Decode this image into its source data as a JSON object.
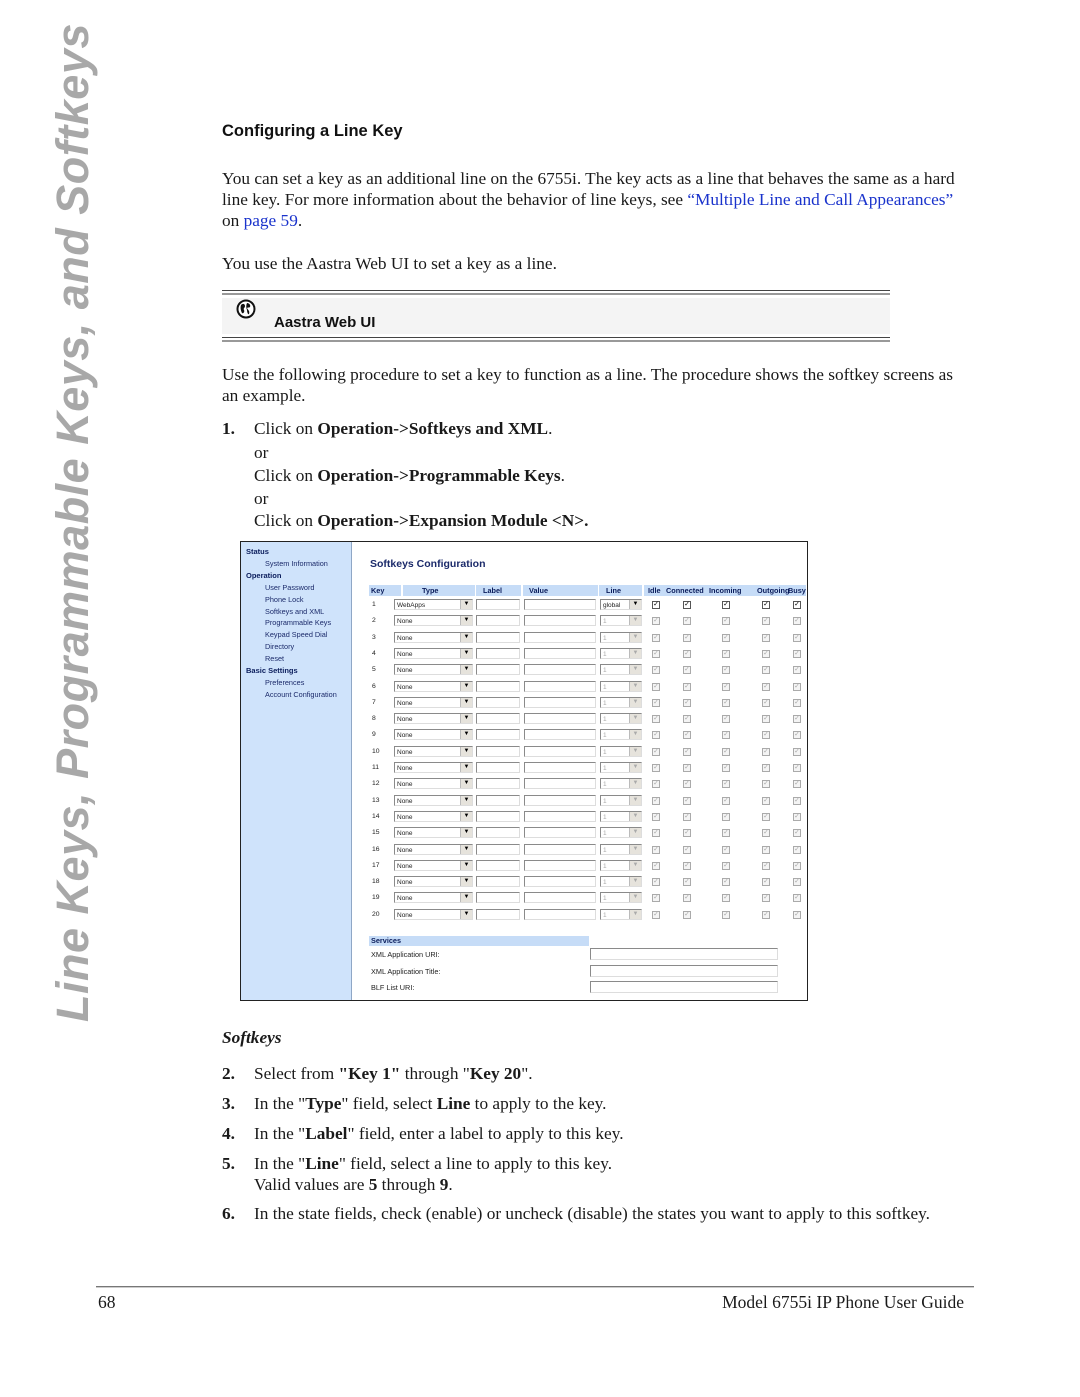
{
  "side_tab": "Line Keys, Programmable Keys, and Softkeys",
  "section_title": "Configuring a Line Key",
  "intro": {
    "text_before": "You can set a key as an additional line on the 6755i. The key acts as a line that behaves the same as a hard line key. For more information about the behavior of line keys, see ",
    "link1": "“Multiple Line and Call Appearances”",
    "text_mid": " on ",
    "link2": "page 59",
    "text_after": "."
  },
  "use_web_ui": "You use the Aastra Web UI to set a key as a line.",
  "web_ui_box": {
    "icon": "globe-icon",
    "label": "Aastra Web UI"
  },
  "procedure_intro": "Use the following procedure to set a key to function as a line. The procedure shows the softkey screens as an example.",
  "step1": {
    "num": "1.",
    "a_pre": "Click on ",
    "a_bold": "Operation->Softkeys and XML",
    "a_post": ".",
    "or1": "or",
    "b_pre": "Click on ",
    "b_bold": "Operation->Programmable Keys",
    "b_post": ".",
    "or2": "or",
    "c_pre": "Click on ",
    "c_bold": "Operation->Expansion Module <N>."
  },
  "screenshot": {
    "nav": [
      {
        "type": "header",
        "label": "Status"
      },
      {
        "type": "item",
        "label": "System Information"
      },
      {
        "type": "header",
        "label": "Operation"
      },
      {
        "type": "item",
        "label": "User Password"
      },
      {
        "type": "item",
        "label": "Phone Lock"
      },
      {
        "type": "item",
        "label": "Softkeys and XML"
      },
      {
        "type": "item",
        "label": "Programmable Keys"
      },
      {
        "type": "item",
        "label": "Keypad Speed Dial"
      },
      {
        "type": "item",
        "label": "Directory"
      },
      {
        "type": "item",
        "label": "Reset"
      },
      {
        "type": "header",
        "label": "Basic Settings"
      },
      {
        "type": "item",
        "label": "Preferences"
      },
      {
        "type": "item",
        "label": "Account Configuration"
      }
    ],
    "title": "Softkeys Configuration",
    "columns": [
      "Key",
      "Type",
      "Label",
      "Value",
      "Line",
      "Idle",
      "Connected",
      "Incoming",
      "Outgoing",
      "Busy"
    ],
    "rows": [
      {
        "key": "1",
        "type": "WebApps",
        "label": "",
        "value": "",
        "line": "global",
        "enabled": true,
        "states": [
          true,
          true,
          true,
          true,
          true
        ]
      },
      {
        "key": "2",
        "type": "None",
        "label": "",
        "value": "",
        "line": "1",
        "enabled": false,
        "states": [
          true,
          true,
          true,
          true,
          true
        ]
      },
      {
        "key": "3",
        "type": "None",
        "label": "",
        "value": "",
        "line": "1",
        "enabled": false,
        "states": [
          true,
          true,
          true,
          true,
          true
        ]
      },
      {
        "key": "4",
        "type": "None",
        "label": "",
        "value": "",
        "line": "1",
        "enabled": false,
        "states": [
          true,
          true,
          true,
          true,
          true
        ]
      },
      {
        "key": "5",
        "type": "None",
        "label": "",
        "value": "",
        "line": "1",
        "enabled": false,
        "states": [
          true,
          true,
          true,
          true,
          true
        ]
      },
      {
        "key": "6",
        "type": "None",
        "label": "",
        "value": "",
        "line": "1",
        "enabled": false,
        "states": [
          true,
          true,
          true,
          true,
          true
        ]
      },
      {
        "key": "7",
        "type": "None",
        "label": "",
        "value": "",
        "line": "1",
        "enabled": false,
        "states": [
          true,
          true,
          true,
          true,
          true
        ]
      },
      {
        "key": "8",
        "type": "None",
        "label": "",
        "value": "",
        "line": "1",
        "enabled": false,
        "states": [
          true,
          true,
          true,
          true,
          true
        ]
      },
      {
        "key": "9",
        "type": "None",
        "label": "",
        "value": "",
        "line": "1",
        "enabled": false,
        "states": [
          true,
          true,
          true,
          true,
          true
        ]
      },
      {
        "key": "10",
        "type": "None",
        "label": "",
        "value": "",
        "line": "1",
        "enabled": false,
        "states": [
          true,
          true,
          true,
          true,
          true
        ]
      },
      {
        "key": "11",
        "type": "None",
        "label": "",
        "value": "",
        "line": "1",
        "enabled": false,
        "states": [
          true,
          true,
          true,
          true,
          true
        ]
      },
      {
        "key": "12",
        "type": "None",
        "label": "",
        "value": "",
        "line": "1",
        "enabled": false,
        "states": [
          true,
          true,
          true,
          true,
          true
        ]
      },
      {
        "key": "13",
        "type": "None",
        "label": "",
        "value": "",
        "line": "1",
        "enabled": false,
        "states": [
          true,
          true,
          true,
          true,
          true
        ]
      },
      {
        "key": "14",
        "type": "None",
        "label": "",
        "value": "",
        "line": "1",
        "enabled": false,
        "states": [
          true,
          true,
          true,
          true,
          true
        ]
      },
      {
        "key": "15",
        "type": "None",
        "label": "",
        "value": "",
        "line": "1",
        "enabled": false,
        "states": [
          true,
          true,
          true,
          true,
          true
        ]
      },
      {
        "key": "16",
        "type": "None",
        "label": "",
        "value": "",
        "line": "1",
        "enabled": false,
        "states": [
          true,
          true,
          true,
          true,
          true
        ]
      },
      {
        "key": "17",
        "type": "None",
        "label": "",
        "value": "",
        "line": "1",
        "enabled": false,
        "states": [
          true,
          true,
          true,
          true,
          true
        ]
      },
      {
        "key": "18",
        "type": "None",
        "label": "",
        "value": "",
        "line": "1",
        "enabled": false,
        "states": [
          true,
          true,
          true,
          true,
          true
        ]
      },
      {
        "key": "19",
        "type": "None",
        "label": "",
        "value": "",
        "line": "1",
        "enabled": false,
        "states": [
          true,
          true,
          true,
          true,
          true
        ]
      },
      {
        "key": "20",
        "type": "None",
        "label": "",
        "value": "",
        "line": "1",
        "enabled": false,
        "states": [
          true,
          true,
          true,
          true,
          true
        ]
      }
    ],
    "services": {
      "header": "Services",
      "fields": [
        {
          "label": "XML Application URI:",
          "value": ""
        },
        {
          "label": "XML Application Title:",
          "value": ""
        },
        {
          "label": "BLF List URI:",
          "value": ""
        }
      ]
    }
  },
  "caption": "Softkeys",
  "steps": [
    {
      "num": "2.",
      "parts": [
        [
          "Select from ",
          false
        ],
        [
          "\"Key 1\"",
          true
        ],
        [
          " through \"",
          false
        ],
        [
          "Key 20",
          true
        ],
        [
          "\".",
          false
        ]
      ]
    },
    {
      "num": "3.",
      "parts": [
        [
          "In the \"",
          false
        ],
        [
          "Type",
          true
        ],
        [
          "\" field, select ",
          false
        ],
        [
          "Line",
          true
        ],
        [
          " to apply to the key.",
          false
        ]
      ]
    },
    {
      "num": "4.",
      "parts": [
        [
          "In the \"",
          false
        ],
        [
          "Label",
          true
        ],
        [
          "\" field, enter a label to apply to this key.",
          false
        ]
      ]
    },
    {
      "num": "5.",
      "parts": [
        [
          "In the \"",
          false
        ],
        [
          "Line",
          true
        ],
        [
          "\" field, select a line to apply to this key.",
          false
        ]
      ],
      "line2": [
        [
          "Valid values are ",
          false
        ],
        [
          "5",
          true
        ],
        [
          " through ",
          false
        ],
        [
          "9",
          true
        ],
        [
          ".",
          false
        ]
      ]
    },
    {
      "num": "6.",
      "parts": [
        [
          "In the state fields, check (enable) or uncheck (disable) the states you want to apply to this softkey.",
          false
        ]
      ]
    }
  ],
  "footer": {
    "page_number": "68",
    "guide_title": "Model 6755i IP Phone User Guide"
  },
  "colors": {
    "link": "#1a33cc",
    "nav_bg": "#cfe3fb",
    "header_bg": "#c6dcf7",
    "side_tab": "#a8a8a8"
  }
}
